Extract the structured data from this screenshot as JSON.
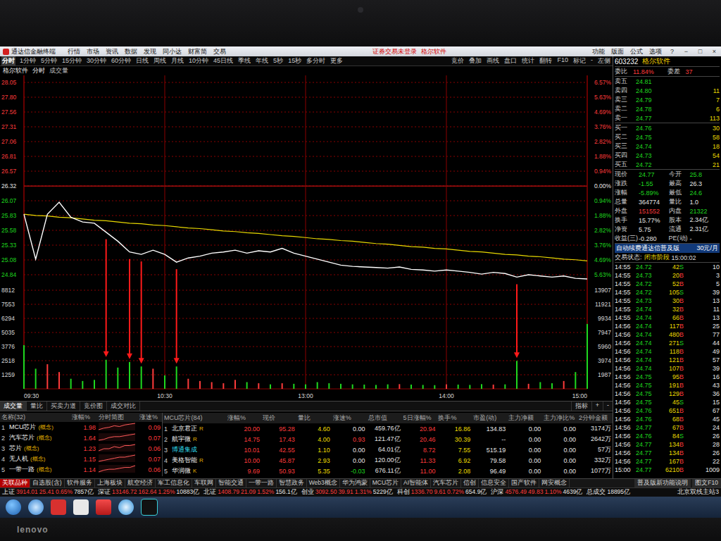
{
  "device": {
    "brand": "lenovo"
  },
  "titlebar": {
    "logo": "通达信金融终端",
    "menus": [
      "行情",
      "市场",
      "资讯",
      "数据",
      "发现",
      "同小达",
      "财富简",
      "交易"
    ],
    "notice": "证券交易未登录",
    "notice_stock": "格尔软件",
    "tools": [
      "功能",
      "版面",
      "公式",
      "选项"
    ],
    "controls": [
      "?",
      "−",
      "□",
      "×"
    ]
  },
  "toolbar": {
    "periods": [
      {
        "label": "分时",
        "selected": true
      },
      {
        "label": "1分钟",
        "selected": false
      },
      {
        "label": "5分钟",
        "selected": false
      },
      {
        "label": "15分钟",
        "selected": false
      },
      {
        "label": "30分钟",
        "selected": false
      },
      {
        "label": "60分钟",
        "selected": false
      },
      {
        "label": "日线",
        "selected": false
      },
      {
        "label": "周线",
        "selected": false
      },
      {
        "label": "月线",
        "selected": false
      },
      {
        "label": "10分钟",
        "selected": false
      },
      {
        "label": "45日线",
        "selected": false
      },
      {
        "label": "季线",
        "selected": false
      },
      {
        "label": "年线",
        "selected": false
      },
      {
        "label": "5秒",
        "selected": false
      },
      {
        "label": "15秒",
        "selected": false
      },
      {
        "label": "多分时",
        "selected": false
      },
      {
        "label": "更多",
        "selected": false
      }
    ],
    "actions": [
      "竞价",
      "叠加",
      "画线",
      "盘口",
      "统计",
      "翻转",
      "F10",
      "标记",
      "-",
      "左侧"
    ]
  },
  "chart": {
    "stock": "格尔软件",
    "mode": "分时",
    "sub": "成交量",
    "prev_close": "26.32",
    "levels": [
      {
        "price": "28.05",
        "pct": "6.57%",
        "dir": "up"
      },
      {
        "price": "27.80",
        "pct": "5.63%",
        "dir": "up"
      },
      {
        "price": "27.56",
        "pct": "4.69%",
        "dir": "up"
      },
      {
        "price": "27.31",
        "pct": "3.76%",
        "dir": "up"
      },
      {
        "price": "27.06",
        "pct": "2.82%",
        "dir": "up"
      },
      {
        "price": "26.81",
        "pct": "1.88%",
        "dir": "up"
      },
      {
        "price": "26.57",
        "pct": "0.94%",
        "dir": "up"
      },
      {
        "price": "26.32",
        "pct": "0.00%",
        "dir": "flat"
      },
      {
        "price": "26.07",
        "pct": "0.94%",
        "dir": "down"
      },
      {
        "price": "25.83",
        "pct": "1.88%",
        "dir": "down"
      },
      {
        "price": "25.58",
        "pct": "2.82%",
        "dir": "down"
      },
      {
        "price": "25.33",
        "pct": "3.76%",
        "dir": "down"
      },
      {
        "price": "25.08",
        "pct": "4.69%",
        "dir": "down"
      },
      {
        "price": "24.84",
        "pct": "5.63%",
        "dir": "down"
      }
    ],
    "vol_levels": [
      "8812",
      "7553",
      "6294",
      "5035",
      "3776",
      "2518",
      "1259"
    ],
    "vol_levels_right": [
      "13907",
      "11921",
      "9934",
      "7947",
      "5960",
      "3974",
      "1987"
    ],
    "times": [
      {
        "label": "09:30",
        "slot": 0
      },
      {
        "label": "10:30",
        "slot": 12
      },
      {
        "label": "13:00",
        "slot": 24
      },
      {
        "label": "14:00",
        "slot": 36
      },
      {
        "label": "15:00",
        "slot": 48
      }
    ],
    "price": [
      25.85,
      25.1,
      25.85,
      26.05,
      25.8,
      25.72,
      25.7,
      25.55,
      25.4,
      25.22,
      25.18,
      25.25,
      25.18,
      25.05,
      25.12,
      25.15,
      25.2,
      25.22,
      25.25,
      25.2,
      25.24,
      25.22,
      25.28,
      25.2,
      25.15,
      25.1,
      25.05,
      25.0,
      24.98,
      24.97,
      24.96,
      24.95,
      24.97,
      24.93,
      24.92,
      24.9,
      24.92,
      24.9,
      24.88,
      24.85,
      24.88,
      24.86,
      24.8,
      24.84,
      24.82,
      24.8,
      24.82,
      24.78,
      24.77
    ],
    "avg": [
      25.85,
      25.83,
      25.82,
      25.8,
      25.79,
      25.77,
      25.75,
      25.74,
      25.72,
      25.7,
      25.69,
      25.67,
      25.66,
      25.64,
      25.62,
      25.61,
      25.59,
      25.57,
      25.56,
      25.54,
      25.53,
      25.51,
      25.49,
      25.48,
      25.46,
      25.44,
      25.43,
      25.41,
      25.4,
      25.38,
      25.36,
      25.35,
      25.33,
      25.31,
      25.3,
      25.28,
      25.27,
      25.25,
      25.23,
      25.22,
      25.2,
      25.18,
      25.17,
      25.15,
      25.14,
      25.12,
      25.1,
      25.09,
      25.07
    ],
    "volume": [
      3900,
      1800,
      2200,
      1500,
      900,
      700,
      800,
      2600,
      1900,
      2400,
      2000,
      1800,
      1200,
      2000,
      900,
      700,
      600,
      500,
      800,
      600,
      500,
      400,
      500,
      450,
      400,
      600,
      500,
      450,
      400,
      380,
      350,
      400,
      420,
      380,
      350,
      330,
      400,
      380,
      350,
      420,
      380,
      400,
      2500,
      450,
      600,
      500,
      700,
      1500,
      5800
    ],
    "arrows": [
      7,
      9,
      10,
      13,
      42
    ]
  },
  "chart_tabs": {
    "tabs": [
      {
        "label": "成交量",
        "selected": true
      },
      {
        "label": "量比",
        "selected": false
      },
      {
        "label": "买卖力道",
        "selected": false
      },
      {
        "label": "竞价图",
        "selected": false
      },
      {
        "label": "成交对比",
        "selected": false
      }
    ],
    "buttons": [
      "指标",
      "+",
      "-"
    ]
  },
  "sectors": {
    "columns": [
      "名称(32)",
      "涨幅%",
      "分时简图",
      "涨速%"
    ],
    "rows": [
      {
        "no": "1",
        "name": "MCU芯片",
        "type_tag": "(概念)",
        "pct": "1.98",
        "speed": "0.09",
        "spark": [
          0,
          2,
          3,
          5,
          4,
          6,
          7,
          8
        ]
      },
      {
        "no": "2",
        "name": "汽车芯片",
        "type_tag": "(概念)",
        "pct": "1.64",
        "speed": "0.07",
        "spark": [
          0,
          1,
          3,
          4,
          4,
          5,
          6,
          7
        ]
      },
      {
        "no": "3",
        "name": "芯片",
        "type_tag": "(概念)",
        "pct": "1.23",
        "speed": "0.06",
        "spark": [
          0,
          2,
          2,
          4,
          3,
          5,
          5,
          6
        ]
      },
      {
        "no": "4",
        "name": "无人机",
        "type_tag": "(概念)",
        "pct": "1.15",
        "speed": "0.07",
        "spark": [
          0,
          1,
          2,
          3,
          4,
          4,
          5,
          6
        ]
      },
      {
        "no": "5",
        "name": "一带一路",
        "type_tag": "(概念)",
        "pct": "1.14",
        "speed": "0.06",
        "spark": [
          0,
          2,
          3,
          3,
          4,
          5,
          5,
          7
        ]
      }
    ]
  },
  "stocks": {
    "columns": [
      "MCU芯片(84)",
      "涨幅%",
      "现价",
      "量比",
      "涨速%",
      "总市值",
      "5日涨幅%",
      "换手%",
      "市盈(动)",
      "主力净额",
      "主力净比%",
      "2分钟金额"
    ],
    "rows": [
      {
        "no": "1",
        "name": "北京君正",
        "tag": "R",
        "highlight": false,
        "values": [
          "20.00",
          "95.28",
          "4.60",
          "0.00",
          "459.76亿",
          "20.94",
          "16.86",
          "134.83",
          "0.00",
          "0.00",
          "3174万"
        ]
      },
      {
        "no": "2",
        "name": "航宇微",
        "tag": "R",
        "highlight": false,
        "values": [
          "14.75",
          "17.43",
          "4.00",
          "0.93",
          "121.47亿",
          "20.46",
          "30.39",
          "--",
          "0.00",
          "0.00",
          "2642万"
        ]
      },
      {
        "no": "3",
        "name": "博通集成",
        "highlight": true,
        "values": [
          "10.01",
          "42.55",
          "1.10",
          "0.00",
          "64.01亿",
          "8.72",
          "7.55",
          "515.19",
          "0.00",
          "0.00",
          "57万"
        ]
      },
      {
        "no": "4",
        "name": "美格智能",
        "tag": "R",
        "highlight": false,
        "values": [
          "10.00",
          "45.87",
          "2.93",
          "0.00",
          "120.00亿",
          "11.33",
          "6.92",
          "79.58",
          "0.00",
          "0.00",
          "332万"
        ]
      },
      {
        "no": "5",
        "name": "华润微",
        "tag": "K",
        "highlight": false,
        "values": [
          "9.69",
          "50.93",
          "5.35",
          "-0.03",
          "676.11亿",
          "11.00",
          "2.08",
          "96.49",
          "0.00",
          "0.00",
          "1077万"
        ]
      }
    ]
  },
  "sheet_tabs": {
    "tabs": [
      {
        "label": "关联品种",
        "selected": true
      },
      {
        "label": "自选股(含)",
        "selected": false
      },
      {
        "label": "软件服务",
        "selected": false
      },
      {
        "label": "上海板块",
        "selected": false
      },
      {
        "label": "航空经济",
        "selected": false
      },
      {
        "label": "军工信息化",
        "selected": false
      },
      {
        "label": "车联网",
        "selected": false
      },
      {
        "label": "智能交通",
        "selected": false
      },
      {
        "label": "一带一路",
        "selected": false
      },
      {
        "label": "智慧政务",
        "selected": false
      },
      {
        "label": "Web3概念",
        "selected": false
      },
      {
        "label": "华为鸿蒙",
        "selected": false
      },
      {
        "label": "MCU芯片",
        "selected": false
      },
      {
        "label": "AI智能体",
        "selected": false
      },
      {
        "label": "汽车芯片",
        "selected": false
      },
      {
        "label": "信创",
        "selected": false
      },
      {
        "label": "信息安全",
        "selected": false
      },
      {
        "label": "国产软件",
        "selected": false
      },
      {
        "label": "网安概念",
        "selected": false
      }
    ],
    "links": [
      "普及版新功能说明",
      "图文F10"
    ]
  },
  "status_bar": {
    "indices": [
      {
        "name": "上证",
        "value": "3914.01",
        "change": "25.41",
        "pct": "0.65%",
        "amount": "7857亿"
      },
      {
        "name": "深证",
        "value": "13146.72",
        "change": "162.64",
        "pct": "1.25%",
        "amount": "10883亿"
      },
      {
        "name": "北证",
        "value": "1408.79",
        "change": "21.09",
        "pct": "1.52%",
        "amount": "156.1亿"
      },
      {
        "name": "创业",
        "value": "3092.50",
        "change": "39.91",
        "pct": "1.31%",
        "amount": "5229亿"
      },
      {
        "name": "科创",
        "value": "1336.70",
        "change": "9.61",
        "pct": "0.72%",
        "amount": "654.9亿"
      },
      {
        "name": "沪深",
        "value": "4576.49",
        "change": "49.83",
        "pct": "1.10%",
        "amount": "4639亿"
      }
    ],
    "total_label": "总成交",
    "total": "18895亿",
    "server": "北京双线主站3"
  },
  "quote": {
    "code": "603232",
    "name": "格尔软件",
    "ratio_label": "委比",
    "ratio": "11.84%",
    "diff_label": "委差",
    "diff": "37",
    "asks": [
      {
        "label": "卖五",
        "price": "24.81"
      },
      {
        "label": "卖四",
        "price": "24.80",
        "vol": "11"
      },
      {
        "label": "卖三",
        "price": "24.79",
        "vol": "7"
      },
      {
        "label": "卖二",
        "price": "24.78",
        "vol": "6"
      },
      {
        "label": "卖一",
        "price": "24.77",
        "vol": "113"
      }
    ],
    "bids": [
      {
        "label": "买一",
        "price": "24.76",
        "vol": "30"
      },
      {
        "label": "买二",
        "price": "24.75",
        "vol": "58"
      },
      {
        "label": "买三",
        "price": "24.74",
        "vol": "18"
      },
      {
        "label": "买四",
        "price": "24.73",
        "vol": "54"
      },
      {
        "label": "买五",
        "price": "24.72",
        "vol": "21"
      }
    ],
    "stats": [
      {
        "l1": "现价",
        "v1": "24.77",
        "t1": "down",
        "l2": "今开",
        "v2": "25.8",
        "t2": "down"
      },
      {
        "l1": "涨跌",
        "v1": "-1.55",
        "t1": "down",
        "l2": "最高",
        "v2": "26.3",
        "t2": "neutral"
      },
      {
        "l1": "涨幅",
        "v1": "-5.89%",
        "t1": "down",
        "l2": "最低",
        "v2": "24.6",
        "t2": "down"
      },
      {
        "l1": "总量",
        "v1": "364774",
        "t1": "neutral",
        "l2": "量比",
        "v2": "1.0",
        "t2": "neutral"
      },
      {
        "l1": "外盘",
        "v1": "151552",
        "t1": "up",
        "l2": "内盘",
        "v2": "21322",
        "t2": "down"
      },
      {
        "l1": "换手",
        "v1": "15.77%",
        "t1": "neutral",
        "l2": "股本",
        "v2": "2.34亿",
        "t2": "neutral"
      },
      {
        "l1": "净资",
        "v1": "5.75",
        "t1": "neutral",
        "l2": "流通",
        "v2": "2.31亿",
        "t2": "neutral"
      },
      {
        "l1": "收益(三)",
        "v1": "-0.280",
        "t1": "neutral",
        "l2": "PE(动)",
        "v2": "-",
        "t2": "neutral"
      }
    ],
    "ad": "自动续费通达信普及版",
    "ad_price": "30元/月",
    "state_label": "交易状态:",
    "state": "闭市阶段",
    "state_time": "15:00:02",
    "ticks": [
      {
        "time": "14:55",
        "price": "24.72",
        "vol": "42",
        "side": "S",
        "count": "10"
      },
      {
        "time": "14:55",
        "price": "24.73",
        "vol": "20",
        "side": "B",
        "count": "3"
      },
      {
        "time": "14:55",
        "price": "24.72",
        "vol": "52",
        "side": "B",
        "count": "5"
      },
      {
        "time": "14:55",
        "price": "24.72",
        "vol": "105",
        "side": "S",
        "count": "39"
      },
      {
        "time": "14:55",
        "price": "24.73",
        "vol": "30",
        "side": "B",
        "count": "13"
      },
      {
        "time": "14:55",
        "price": "24.74",
        "vol": "32",
        "side": "B",
        "count": "11"
      },
      {
        "time": "14:55",
        "price": "24.74",
        "vol": "66",
        "side": "B",
        "count": "13"
      },
      {
        "time": "14:56",
        "price": "24.74",
        "vol": "117",
        "side": "B",
        "count": "25"
      },
      {
        "time": "14:56",
        "price": "24.74",
        "vol": "480",
        "side": "B",
        "count": "77"
      },
      {
        "time": "14:56",
        "price": "24.74",
        "vol": "271",
        "side": "S",
        "count": "44"
      },
      {
        "time": "14:56",
        "price": "24.74",
        "vol": "118",
        "side": "B",
        "count": "49"
      },
      {
        "time": "14:56",
        "price": "24.74",
        "vol": "121",
        "side": "B",
        "count": "57"
      },
      {
        "time": "14:56",
        "price": "24.74",
        "vol": "107",
        "side": "B",
        "count": "39"
      },
      {
        "time": "14:56",
        "price": "24.75",
        "vol": "95",
        "side": "B",
        "count": "16"
      },
      {
        "time": "14:56",
        "price": "24.75",
        "vol": "191",
        "side": "B",
        "count": "43"
      },
      {
        "time": "14:56",
        "price": "24.75",
        "vol": "129",
        "side": "B",
        "count": "36"
      },
      {
        "time": "14:56",
        "price": "24.75",
        "vol": "45",
        "side": "S",
        "count": "15"
      },
      {
        "time": "14:56",
        "price": "24.76",
        "vol": "651",
        "side": "B",
        "count": "67"
      },
      {
        "time": "14:56",
        "price": "24.76",
        "vol": "68",
        "side": "B",
        "count": "45"
      },
      {
        "time": "14:56",
        "price": "24.77",
        "vol": "67",
        "side": "B",
        "count": "24"
      },
      {
        "time": "14:56",
        "price": "24.76",
        "vol": "84",
        "side": "S",
        "count": "26"
      },
      {
        "time": "14:56",
        "price": "24.77",
        "vol": "134",
        "side": "B",
        "count": "28"
      },
      {
        "time": "14:56",
        "price": "24.77",
        "vol": "134",
        "side": "B",
        "count": "26"
      },
      {
        "time": "14:56",
        "price": "24.77",
        "vol": "167",
        "side": "B",
        "count": "22"
      },
      {
        "time": "15:00",
        "price": "24.77",
        "vol": "6210",
        "side": "B",
        "count": "1009"
      }
    ]
  }
}
